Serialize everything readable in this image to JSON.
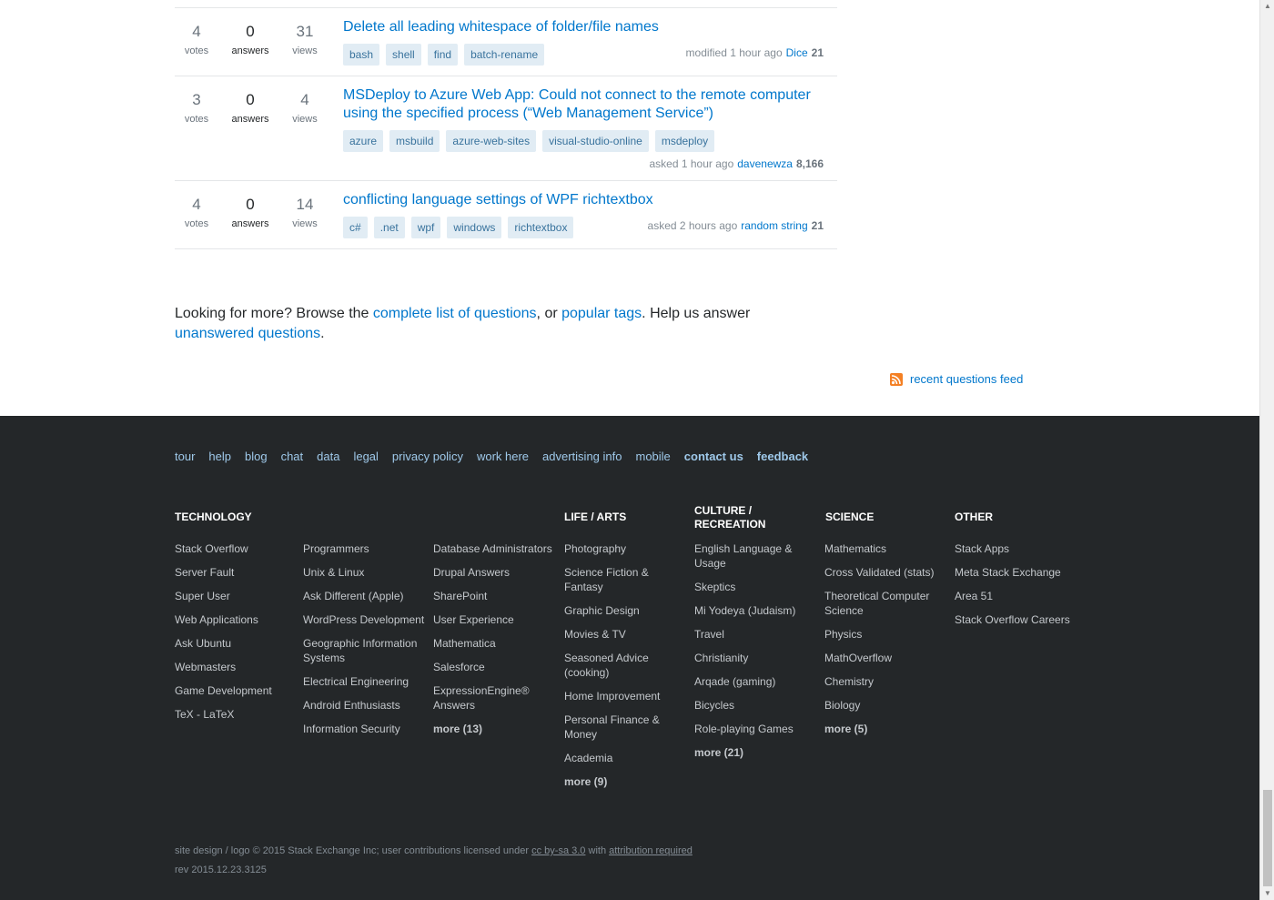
{
  "questions": [
    {
      "votes": "4",
      "votes_label": "votes",
      "answers": "0",
      "answers_label": "answers",
      "views": "31",
      "views_label": "views",
      "title": "Delete all leading whitespace of folder/file names",
      "tags": [
        "bash",
        "shell",
        "find",
        "batch-rename"
      ],
      "meta_action": "modified 1 hour ago",
      "user": "Dice",
      "rep": "21"
    },
    {
      "votes": "3",
      "votes_label": "votes",
      "answers": "0",
      "answers_label": "answers",
      "views": "4",
      "views_label": "views",
      "title": "MSDeploy to Azure Web App: Could not connect to the remote computer using the specified process (“Web Management Service”)",
      "tags": [
        "azure",
        "msbuild",
        "azure-web-sites",
        "visual-studio-online",
        "msdeploy"
      ],
      "meta_action": "asked 1 hour ago",
      "user": "davenewza",
      "rep": "8,166"
    },
    {
      "votes": "4",
      "votes_label": "votes",
      "answers": "0",
      "answers_label": "answers",
      "views": "14",
      "views_label": "views",
      "title": "conflicting language settings of WPF richtextbox",
      "tags": [
        "c#",
        ".net",
        "wpf",
        "windows",
        "richtextbox"
      ],
      "meta_action": "asked 2 hours ago",
      "user": "random string",
      "rep": "21"
    }
  ],
  "more": {
    "prefix": "Looking for more? Browse the ",
    "link1": "complete list of questions",
    "mid": ", or ",
    "link2": "popular tags",
    "suffix": ". Help us answer ",
    "link3": "unanswered questions",
    "end": "."
  },
  "feed": {
    "label": "recent questions feed",
    "icon": "rss-icon"
  },
  "footer": {
    "nav": [
      "tour",
      "help",
      "blog",
      "chat",
      "data",
      "legal",
      "privacy policy",
      "work here",
      "advertising info",
      "mobile",
      "contact us",
      "feedback"
    ],
    "columns": [
      {
        "heading": "Technology",
        "links": [
          "Stack Overflow",
          "Server Fault",
          "Super User",
          "Web Applications",
          "Ask Ubuntu",
          "Webmasters",
          "Game Development",
          "TeX - LaTeX"
        ]
      },
      {
        "heading": "",
        "links": [
          "Programmers",
          "Unix & Linux",
          "Ask Different (Apple)",
          "WordPress Development",
          "Geographic Information Systems",
          "Electrical Engineering",
          "Android Enthusiasts",
          "Information Security"
        ]
      },
      {
        "heading": "",
        "links": [
          "Database Administrators",
          "Drupal Answers",
          "SharePoint",
          "User Experience",
          "Mathematica",
          "Salesforce",
          "ExpressionEngine® Answers"
        ],
        "more": "more (13)"
      },
      {
        "heading": "Life / Arts",
        "links": [
          "Photography",
          "Science Fiction & Fantasy",
          "Graphic Design",
          "Movies & TV",
          "Seasoned Advice (cooking)",
          "Home Improvement",
          "Personal Finance & Money",
          "Academia"
        ],
        "more": "more (9)"
      },
      {
        "heading": "Culture / Recreation",
        "links": [
          "English Language & Usage",
          "Skeptics",
          "Mi Yodeya (Judaism)",
          "Travel",
          "Christianity",
          "Arqade (gaming)",
          "Bicycles",
          "Role-playing Games"
        ],
        "more": "more (21)"
      },
      {
        "heading": "Science",
        "links": [
          "Mathematics",
          "Cross Validated (stats)",
          "Theoretical Computer Science",
          "Physics",
          "MathOverflow",
          "Chemistry",
          "Biology"
        ],
        "more": "more (5)"
      },
      {
        "heading": "Other",
        "links": [
          "Stack Apps",
          "Meta Stack Exchange",
          "Area 51",
          "Stack Overflow Careers"
        ]
      }
    ],
    "copyright_prefix": "site design / logo © 2015 Stack Exchange Inc; user contributions licensed under ",
    "license": "cc by-sa 3.0",
    "copyright_mid": " with ",
    "attribution": "attribution required",
    "rev": "rev 2015.12.23.3125"
  }
}
